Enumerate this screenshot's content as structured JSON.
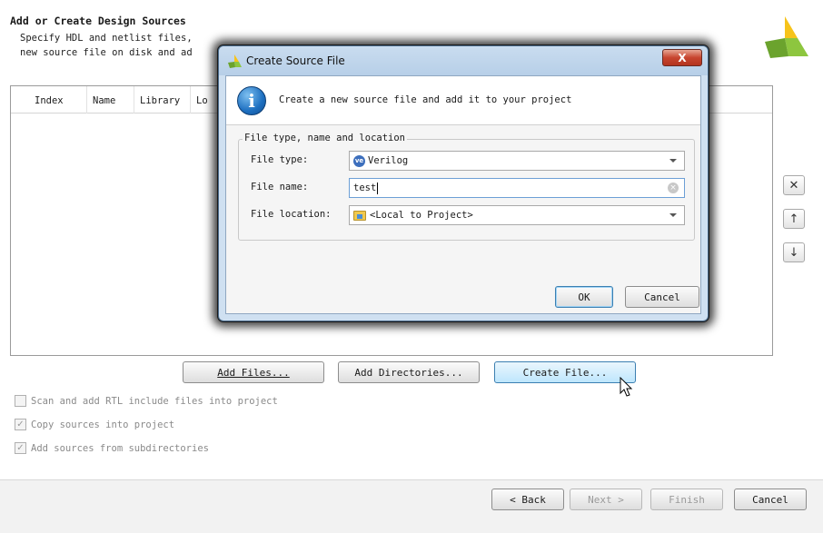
{
  "wizard": {
    "title": "Add or Create Design Sources",
    "description": "Specify HDL and netlist files, or directories containing HDL and netlist files, to add to your project. Create a\nnew source file on disk and add it to your project.",
    "description_visible": "Specify HDL and netlist files,\nnew source file on disk and ad",
    "table": {
      "columns": [
        "Index",
        "Name",
        "Library",
        "Lo"
      ]
    },
    "side_buttons": [
      {
        "name": "remove",
        "icon": "x-icon",
        "glyph": "✕"
      },
      {
        "name": "move-up",
        "icon": "arrow-up-icon",
        "glyph": "↑"
      },
      {
        "name": "move-down",
        "icon": "arrow-down-icon",
        "glyph": "↓"
      }
    ],
    "buttons": {
      "add_files": "Add Files...",
      "add_directories": "Add Directories...",
      "create_file": "Create File..."
    },
    "options": [
      {
        "label": "Scan and add RTL include files into project",
        "checked": false,
        "enabled": false
      },
      {
        "label": "Copy sources into project",
        "checked": true,
        "enabled": false
      },
      {
        "label": "Add sources from subdirectories",
        "checked": true,
        "enabled": false
      }
    ],
    "nav": {
      "back": "< Back",
      "next": "Next >",
      "finish": "Finish",
      "cancel": "Cancel"
    }
  },
  "dialog": {
    "title": "Create Source File",
    "close_glyph": "X",
    "banner_text": "Create a new source file and add it to your project",
    "group_label": "File type, name and location",
    "file_type_label": "File type:",
    "file_type_value": "Verilog",
    "file_type_badge": "ve",
    "file_name_label": "File name:",
    "file_name_value": "test",
    "file_location_label": "File location:",
    "file_location_value": "<Local to Project>",
    "ok": "OK",
    "cancel": "Cancel"
  },
  "colors": {
    "accent": "#3c7fb1",
    "close_button": "#c7452f",
    "logo": "#8dc63f"
  }
}
